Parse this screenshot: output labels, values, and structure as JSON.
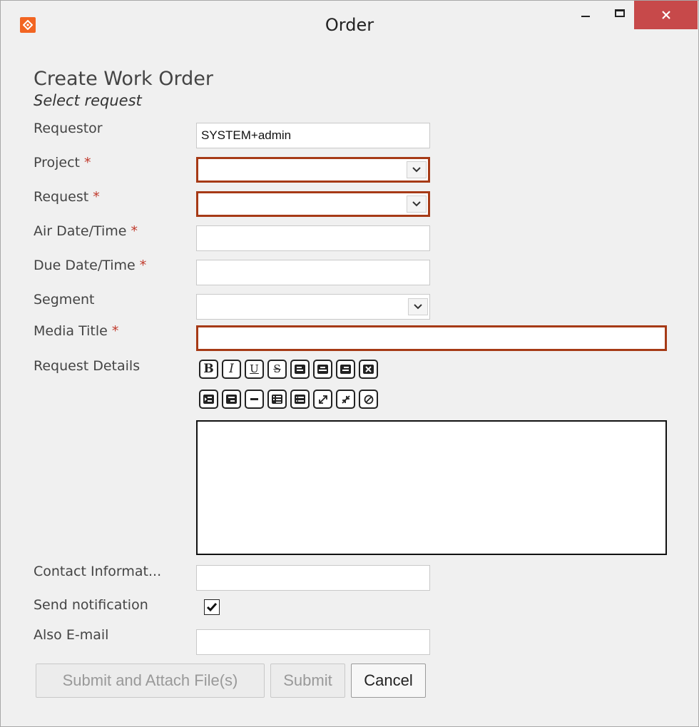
{
  "window": {
    "title": "Order"
  },
  "form": {
    "heading": "Create Work Order",
    "subheading": "Select request",
    "required_marker": "*",
    "fields": {
      "requestor": {
        "label": "Requestor",
        "value": "SYSTEM+admin"
      },
      "project": {
        "label": "Project",
        "value": ""
      },
      "request": {
        "label": "Request",
        "value": ""
      },
      "air_date": {
        "label": "Air Date/Time",
        "value": ""
      },
      "due_date": {
        "label": "Due Date/Time",
        "value": ""
      },
      "segment": {
        "label": "Segment",
        "value": ""
      },
      "media_title": {
        "label": "Media Title",
        "value": ""
      },
      "request_details": {
        "label": "Request Details"
      },
      "contact": {
        "label": "Contact Informat...",
        "value": ""
      },
      "send_notification": {
        "label": "Send notification",
        "checked": true
      },
      "also_email": {
        "label": "Also E-mail",
        "value": ""
      }
    },
    "toolbar": {
      "bold": "B",
      "italic": "I",
      "underline": "U",
      "strike": "S"
    },
    "buttons": {
      "submit_attach": "Submit and Attach File(s)",
      "submit": "Submit",
      "cancel": "Cancel"
    }
  },
  "colors": {
    "error_border": "#a63a16",
    "required_star": "#c0392b",
    "close_button": "#c7494a",
    "app_icon": "#f26522"
  }
}
